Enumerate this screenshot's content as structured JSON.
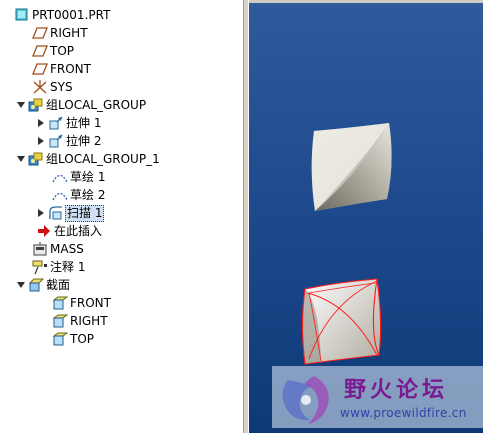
{
  "tree": {
    "items": [
      {
        "label": "PRT0001.PRT",
        "icon": "part-icon",
        "expanded": true
      },
      {
        "label": "RIGHT",
        "icon": "datum-plane-icon"
      },
      {
        "label": "TOP",
        "icon": "datum-plane-icon"
      },
      {
        "label": "FRONT",
        "icon": "datum-plane-icon"
      },
      {
        "label": "SYS",
        "icon": "coordinate-system-icon"
      },
      {
        "label": "组LOCAL_GROUP",
        "icon": "group-icon",
        "expanded": true
      },
      {
        "label": "拉伸 1",
        "icon": "extrude-icon",
        "expanded": false
      },
      {
        "label": "拉伸 2",
        "icon": "extrude-icon",
        "expanded": false
      },
      {
        "label": "组LOCAL_GROUP_1",
        "icon": "group-icon",
        "expanded": true
      },
      {
        "label": "草绘 1",
        "icon": "sketch-icon"
      },
      {
        "label": "草绘 2",
        "icon": "sketch-icon"
      },
      {
        "label": "扫描 1",
        "icon": "sweep-icon",
        "expanded": false,
        "selected": true
      },
      {
        "label": "在此插入",
        "icon": "insert-here-arrow-icon"
      },
      {
        "label": "MASS",
        "icon": "mass-properties-icon"
      },
      {
        "label": "注释 1",
        "icon": "annotation-icon"
      },
      {
        "label": "截面",
        "icon": "cross-section-folder-icon",
        "expanded": true
      },
      {
        "label": "FRONT",
        "icon": "section-plane-icon"
      },
      {
        "label": "RIGHT",
        "icon": "section-plane-icon"
      },
      {
        "label": "TOP",
        "icon": "section-plane-icon"
      }
    ]
  },
  "watermark": {
    "title": "野火论坛",
    "url": "www.proewildfire.cn",
    "icon": "flame-swirl-logo-icon"
  },
  "colors": {
    "viewport_top": "#2f5a9c",
    "viewport_bottom": "#0e3977",
    "selection_edge": "#ff1a1a",
    "tree_selection": "#cfe0f4",
    "watermark_title": "#7b1a92",
    "watermark_url": "#3040a8"
  }
}
